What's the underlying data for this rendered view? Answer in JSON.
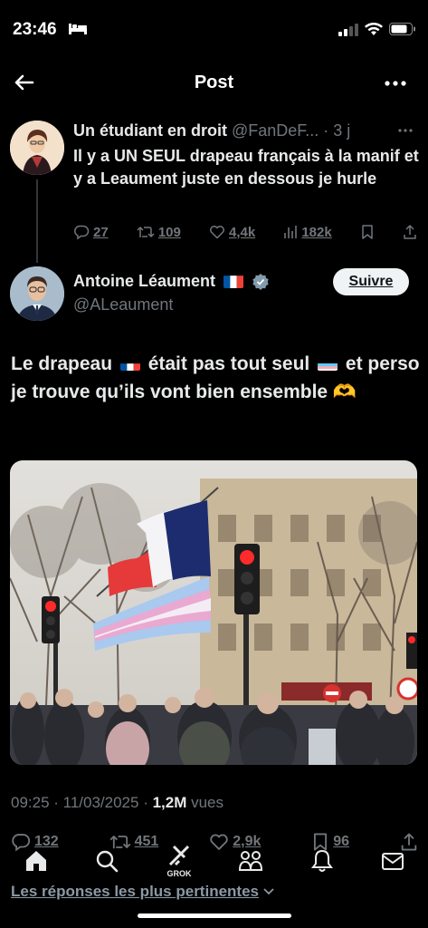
{
  "status_bar": {
    "time": "23:46"
  },
  "header": {
    "title": "Post"
  },
  "parent_tweet": {
    "author_name": "Un étudiant en droit",
    "handle_time": " @FanDeF... · 3 j",
    "text": "Il y a UN SEUL drapeau français à la manif et y a Leaument juste en dessous je hurle",
    "replies": "27",
    "reposts": "109",
    "likes": "4,4k",
    "views": "182k"
  },
  "main_tweet": {
    "author_name": "Antoine Léaument",
    "handle": "@ALeaument",
    "follow_label": "Suivre",
    "text_part1": "Le drapeau ",
    "text_part2": " était pas tout seul ",
    "text_part3": " et perso je trouve qu’ils vont bien ensemble ",
    "emoji_hands": "🫶",
    "timestamp": "09:25 · 11/03/2025 · ",
    "views_count": "1,2M",
    "views_label": " vues",
    "replies": "132",
    "reposts": "451",
    "likes": "2,9k",
    "bookmarks": "96"
  },
  "nav": {
    "grok_label": "GROK"
  },
  "replies_sort_label": "Les réponses les plus pertinentes",
  "colors": {
    "background": "#000000",
    "text": "#e7e9ea",
    "muted": "#71767b",
    "verified": "#829aab",
    "follow_bg": "#eff3f4"
  }
}
